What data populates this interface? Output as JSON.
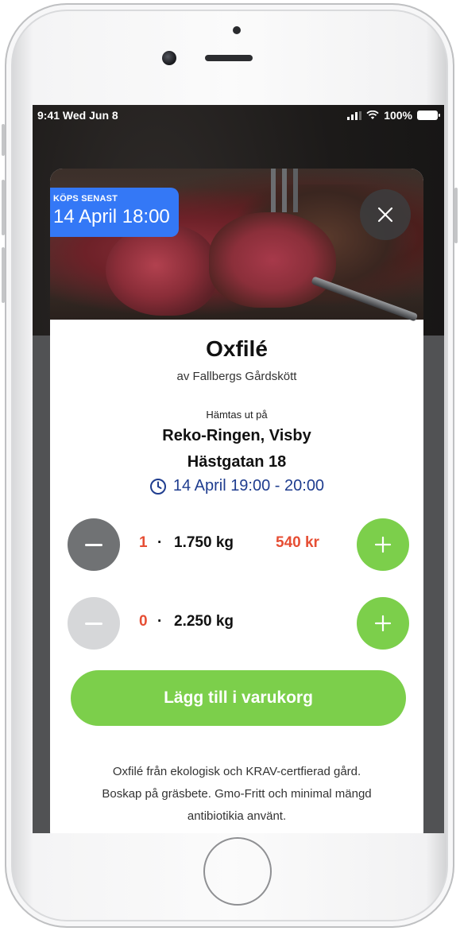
{
  "status_bar": {
    "time": "9:41",
    "date": "Wed Jun 8",
    "battery": "100%"
  },
  "product": {
    "deadline_label": "KÖPS SENAST",
    "deadline_value": "14 April 18:00",
    "title": "Oxfilé",
    "producer": "av Fallbergs Gårdskött",
    "pickup_label": "Hämtas ut på",
    "pickup_place": "Reko-Ringen, Visby",
    "pickup_street": "Hästgatan 18",
    "pickup_time": "14 April 19:00 - 20:00",
    "description_lines": [
      "Oxfilé från ekologisk och KRAV-certfierad gård.",
      "Boskap på gräsbete. Gmo-Fritt och minimal mängd",
      "antibiotikia använt."
    ]
  },
  "options": [
    {
      "quantity": "1",
      "separator": "·",
      "weight": "1.750 kg",
      "price": "540 kr"
    },
    {
      "quantity": "0",
      "separator": "·",
      "weight": "2.250 kg",
      "price": ""
    }
  ],
  "actions": {
    "add_to_cart": "Lägg till i varukorg"
  },
  "icons": {
    "close": "close-icon",
    "minus": "minus-icon",
    "plus": "plus-icon",
    "clock": "clock-icon",
    "signal": "signal-icon",
    "wifi": "wifi-icon",
    "battery": "battery-icon"
  },
  "colors": {
    "accent_green": "#7ccf4b",
    "badge_blue": "#3478f6",
    "price_red": "#e64e34",
    "time_blue": "#1f3d8f"
  }
}
